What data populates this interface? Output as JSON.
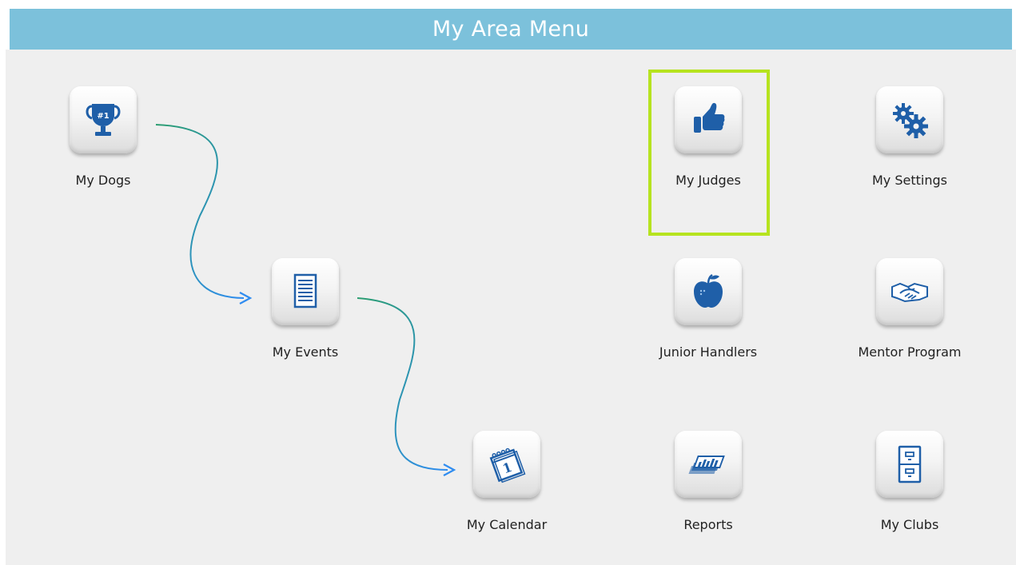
{
  "header": {
    "title": "My Area Menu"
  },
  "colors": {
    "header_bg": "#7cc1db",
    "highlight": "#b6e31f",
    "icon_blue": "#1f5fa8",
    "arrow_start": "#2a9d6f",
    "arrow_end": "#2f8cf0"
  },
  "tiles": [
    {
      "label": "My Dogs",
      "icon": "trophy-icon"
    },
    {
      "label": "My Events",
      "icon": "document-icon"
    },
    {
      "label": "My Calendar",
      "icon": "calendar-icon"
    },
    {
      "label": "My Judges",
      "icon": "thumbs-up-icon"
    },
    {
      "label": "Junior Handlers",
      "icon": "apple-icon"
    },
    {
      "label": "Reports",
      "icon": "reports-icon"
    },
    {
      "label": "My Settings",
      "icon": "gears-icon"
    },
    {
      "label": "Mentor Program",
      "icon": "handshake-icon"
    },
    {
      "label": "My Clubs",
      "icon": "file-cabinet-icon"
    }
  ],
  "trophy_text": "#1",
  "calendar_text": "1",
  "selected_tile": "My Judges"
}
